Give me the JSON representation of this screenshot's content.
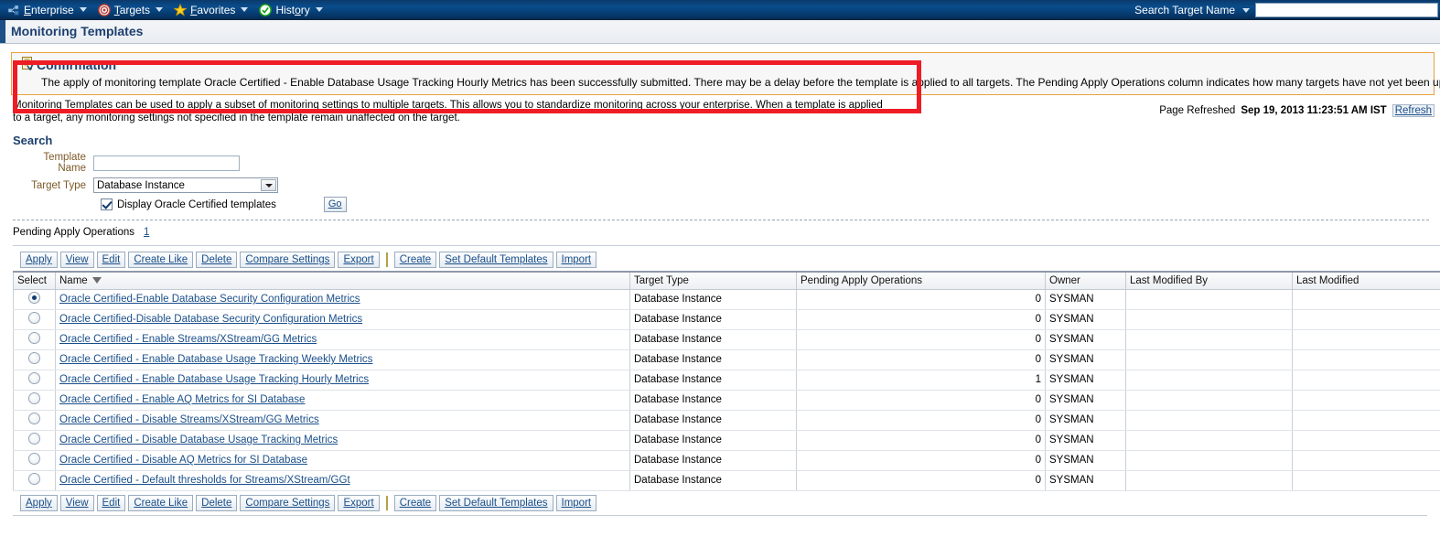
{
  "topnav": {
    "items": [
      {
        "label": "Enterprise",
        "accel": "E",
        "icon": "enterprise-icon",
        "has_caret": true
      },
      {
        "label": "Targets",
        "accel": "T",
        "icon": "targets-icon",
        "has_caret": true
      },
      {
        "label": "Favorites",
        "accel": "F",
        "icon": "favorites-star-icon",
        "has_caret": true
      },
      {
        "label": "History",
        "accel": "o",
        "icon": "history-check-icon",
        "has_caret": true
      }
    ],
    "search_label": "Search Target Name",
    "search_value": "",
    "search_placeholder": ""
  },
  "page": {
    "title": "Monitoring Templates",
    "intro": "Monitoring Templates can be used to apply a subset of monitoring settings to multiple targets. This allows you to standardize monitoring across your enterprise. When a template is applied to a target, any monitoring settings not specified in the template remain unaffected on the target.",
    "refreshed_label": "Page Refreshed",
    "refreshed_time": "Sep 19, 2013 11:23:51 AM IST",
    "refresh_link": "Refresh"
  },
  "confirmation": {
    "icon": "confirmation-icon",
    "title": "Confirmation",
    "message": "The apply of monitoring template Oracle Certified - Enable Database Usage Tracking Hourly Metrics has been successfully submitted. There may be a delay before the template is applied to all targets. The Pending Apply Operations column indicates how many targets have not yet been updated.",
    "border_color": "#e8a33d",
    "annotation_color": "#ee1c25"
  },
  "search": {
    "heading": "Search",
    "template_name_label": "Template Name",
    "template_name_value": "",
    "target_type_label": "Target Type",
    "target_type_value": "Database Instance",
    "checkbox_label": "Display Oracle Certified templates",
    "checkbox_checked": true,
    "go_label": "Go"
  },
  "pending": {
    "label": "Pending Apply Operations",
    "count": "1"
  },
  "toolbar": {
    "buttons": [
      "Apply",
      "View",
      "Edit",
      "Create Like",
      "Delete",
      "Compare Settings",
      "Export"
    ],
    "buttons2": [
      "Create",
      "Set Default Templates",
      "Import"
    ]
  },
  "table": {
    "columns": [
      "Select",
      "Name",
      "Target Type",
      "Pending Apply Operations",
      "Owner",
      "Last Modified By",
      "Last Modified"
    ],
    "sorted_column": "Name",
    "sort_direction": "desc",
    "rows": [
      {
        "selected": true,
        "name": "Oracle Certified-Enable Database Security Configuration Metrics",
        "target_type": "Database Instance",
        "pending": "0",
        "owner": "SYSMAN",
        "last_modified_by": "",
        "last_modified": ""
      },
      {
        "selected": false,
        "name": "Oracle Certified-Disable Database Security Configuration Metrics",
        "target_type": "Database Instance",
        "pending": "0",
        "owner": "SYSMAN",
        "last_modified_by": "",
        "last_modified": ""
      },
      {
        "selected": false,
        "name": "Oracle Certified - Enable Streams/XStream/GG Metrics",
        "target_type": "Database Instance",
        "pending": "0",
        "owner": "SYSMAN",
        "last_modified_by": "",
        "last_modified": ""
      },
      {
        "selected": false,
        "name": "Oracle Certified - Enable Database Usage Tracking Weekly Metrics",
        "target_type": "Database Instance",
        "pending": "0",
        "owner": "SYSMAN",
        "last_modified_by": "",
        "last_modified": ""
      },
      {
        "selected": false,
        "name": "Oracle Certified - Enable Database Usage Tracking Hourly Metrics",
        "target_type": "Database Instance",
        "pending": "1",
        "owner": "SYSMAN",
        "last_modified_by": "",
        "last_modified": ""
      },
      {
        "selected": false,
        "name": "Oracle Certified - Enable AQ Metrics for SI Database",
        "target_type": "Database Instance",
        "pending": "0",
        "owner": "SYSMAN",
        "last_modified_by": "",
        "last_modified": ""
      },
      {
        "selected": false,
        "name": "Oracle Certified - Disable Streams/XStream/GG Metrics",
        "target_type": "Database Instance",
        "pending": "0",
        "owner": "SYSMAN",
        "last_modified_by": "",
        "last_modified": ""
      },
      {
        "selected": false,
        "name": "Oracle Certified - Disable Database Usage Tracking Metrics",
        "target_type": "Database Instance",
        "pending": "0",
        "owner": "SYSMAN",
        "last_modified_by": "",
        "last_modified": ""
      },
      {
        "selected": false,
        "name": "Oracle Certified - Disable AQ Metrics for SI Database",
        "target_type": "Database Instance",
        "pending": "0",
        "owner": "SYSMAN",
        "last_modified_by": "",
        "last_modified": ""
      },
      {
        "selected": false,
        "name": "Oracle Certified - Default thresholds for Streams/XStream/GGt",
        "target_type": "Database Instance",
        "pending": "0",
        "owner": "SYSMAN",
        "last_modified_by": "",
        "last_modified": ""
      }
    ]
  }
}
